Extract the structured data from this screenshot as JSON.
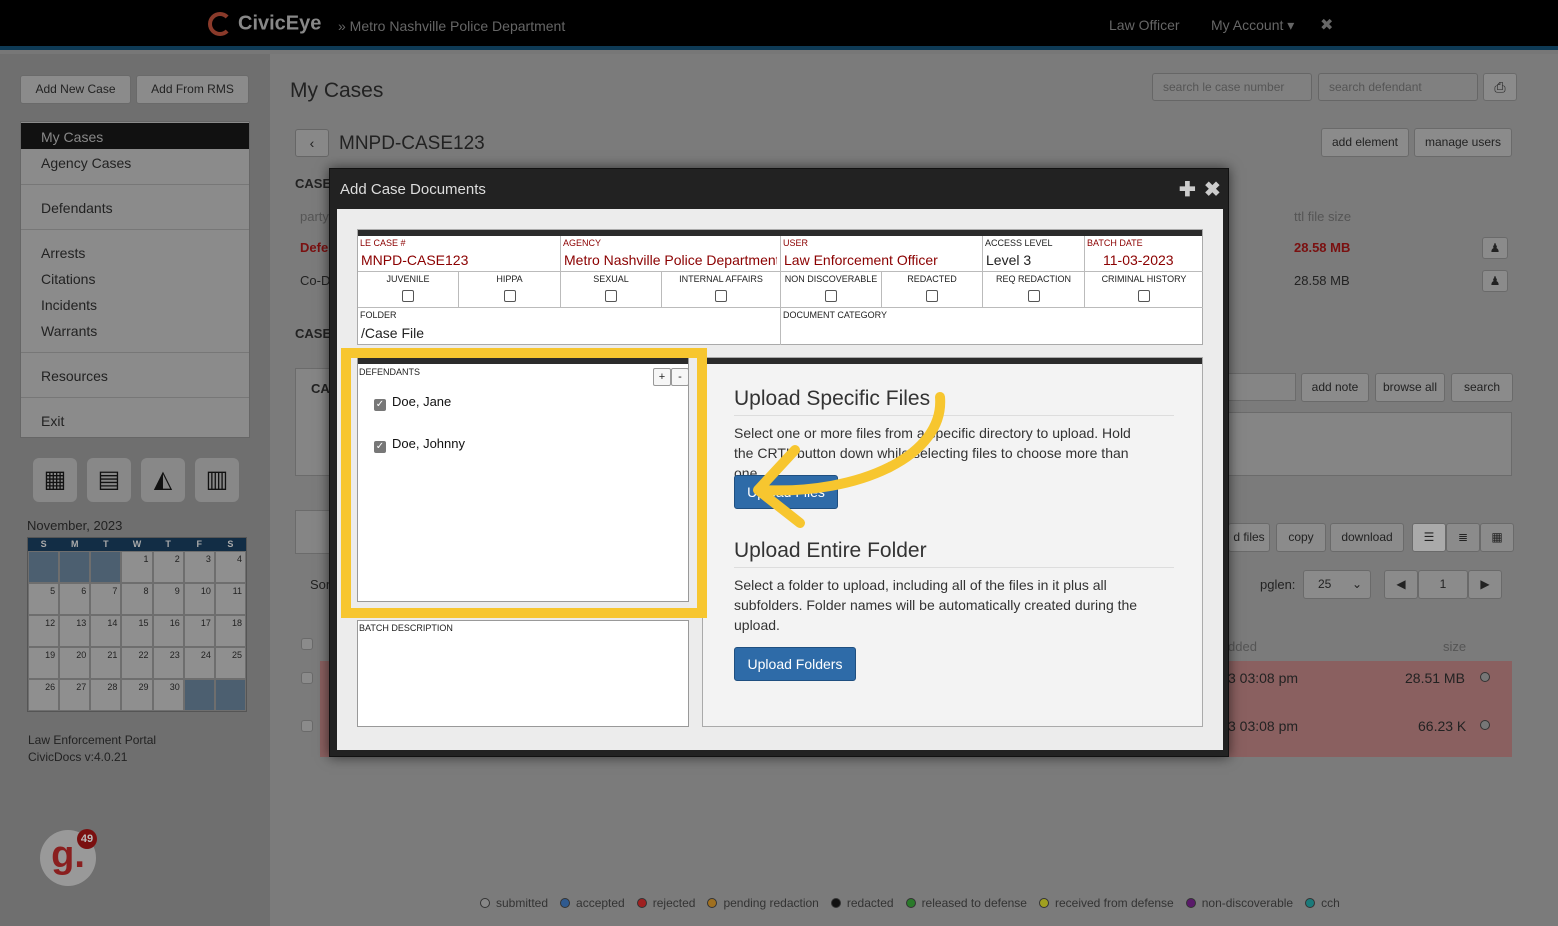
{
  "app": {
    "brand": "CivicEye",
    "department": "» Metro Nashville Police Department",
    "nav_right": [
      "Law Officer",
      "My Account ▾"
    ],
    "close_symbol": "✖"
  },
  "sidebar": {
    "buttons": [
      "Add New Case",
      "Add From RMS"
    ],
    "items": [
      "My Cases",
      "Agency Cases",
      "Defendants",
      "Arrests",
      "Citations",
      "Incidents",
      "Warrants",
      "Resources",
      "Exit"
    ],
    "calendar": {
      "month": "November, 2023",
      "days": [
        "S",
        "M",
        "T",
        "W",
        "T",
        "F",
        "S"
      ],
      "weeks": [
        [
          "",
          "",
          "",
          "1",
          "2",
          "3",
          "4"
        ],
        [
          "5",
          "6",
          "7",
          "8",
          "9",
          "10",
          "11"
        ],
        [
          "12",
          "13",
          "14",
          "15",
          "16",
          "17",
          "18"
        ],
        [
          "19",
          "20",
          "21",
          "22",
          "23",
          "24",
          "25"
        ],
        [
          "26",
          "27",
          "28",
          "29",
          "30",
          "",
          ""
        ]
      ]
    },
    "footer_line1": "Law Enforcement Portal",
    "footer_line2": "CivicDocs v:4.0.21",
    "badge_letter": "g.",
    "badge_count": "49"
  },
  "main": {
    "title": "My Cases",
    "search_case_placeholder": "search le case number",
    "search_defendant_placeholder": "search defendant",
    "case_number": "MNPD-CASE123",
    "add_element": "add element",
    "manage_users": "manage users",
    "bg_labels": {
      "case_hdr1": "CASE",
      "case_hdr2": "CASE",
      "party": "party",
      "defe": "Defe",
      "cod": "Co-D",
      "ca": "CA",
      "ttl_file_size": "ttl file size",
      "size1": "28.58 MB",
      "size2": "28.58 MB",
      "add_note": "add note",
      "browse_all": "browse all",
      "search": "search",
      "d_files": "d files",
      "copy": "copy",
      "download": "download",
      "sort": "Sor",
      "pglen": "pglen:",
      "pglen_value": "25",
      "page_num": "1",
      "added": "dded",
      "size_hdr": "size",
      "row1_time": "3 03:08 pm",
      "row1_size": "28.51 MB",
      "row2_time": "3 03:08 pm",
      "row2_size": "66.23 K"
    },
    "legend": [
      {
        "label": "submitted",
        "color": "#888888"
      },
      {
        "label": "accepted",
        "color": "#2f5a8f"
      },
      {
        "label": "rejected",
        "color": "#a02020"
      },
      {
        "label": "pending redaction",
        "color": "#a07020"
      },
      {
        "label": "redacted",
        "color": "#111111"
      },
      {
        "label": "released to defense",
        "color": "#2a7a2a"
      },
      {
        "label": "received from defense",
        "color": "#a0a020"
      },
      {
        "label": "non-discoverable",
        "color": "#5a1a6a"
      },
      {
        "label": "cch",
        "color": "#1a7a7a"
      }
    ]
  },
  "modal": {
    "title": "Add Case Documents",
    "fields": {
      "le_case_label": "LE CASE #",
      "le_case_value": "MNPD-CASE123",
      "agency_label": "AGENCY",
      "agency_value": "Metro Nashville Police Department",
      "user_label": "USER",
      "user_value": "Law Enforcement Officer",
      "access_label": "ACCESS LEVEL",
      "access_value": "Level 3",
      "batch_label": "BATCH DATE",
      "batch_value": "11-03-2023",
      "folder_label": "FOLDER",
      "folder_value": "/Case File",
      "doc_category_label": "DOCUMENT CATEGORY"
    },
    "checkboxes": [
      "JUVENILE",
      "HIPPA",
      "SEXUAL",
      "INTERNAL AFFAIRS",
      "NON DISCOVERABLE",
      "REDACTED",
      "REQ REDACTION",
      "CRIMINAL HISTORY"
    ],
    "defendants_label": "DEFENDANTS",
    "defendants": [
      "Doe, Jane",
      "Doe, Johnny"
    ],
    "plus": "+",
    "minus": "-",
    "batch_desc_label": "BATCH DESCRIPTION",
    "upload_specific_title": "Upload Specific Files",
    "upload_specific_text": "Select one or more files from a specific directory to upload. Hold the CRTL button down while selecting files to choose more than one.",
    "upload_files_button": "Upload Files",
    "upload_folder_title": "Upload Entire Folder",
    "upload_folder_text": "Select a folder to upload, including all of the files in it plus all subfolders. Folder names will be automatically created during the upload.",
    "upload_folders_button": "Upload Folders"
  },
  "colors": {
    "highlight": "#f7c62f",
    "primary_button": "#2e6ba8",
    "field_value": "#8b0000"
  }
}
